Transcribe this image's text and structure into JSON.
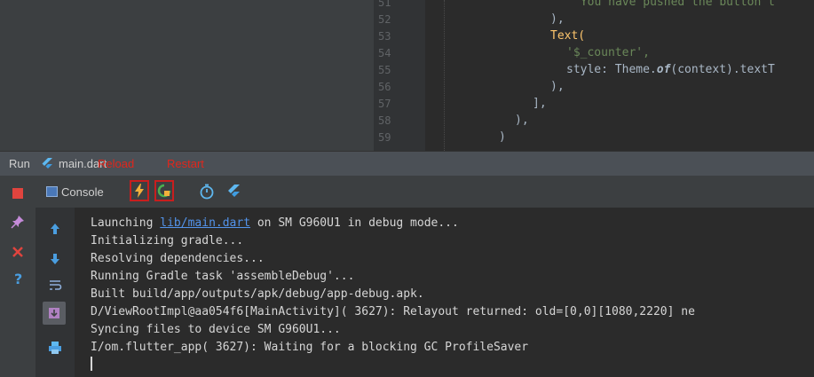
{
  "editor": {
    "line_numbers": [
      "51",
      "52",
      "53",
      "54",
      "55",
      "56",
      "57",
      "58",
      "59"
    ],
    "code_lines": [
      {
        "indent": "            ",
        "text": "'You have pushed the button t",
        "kind": "str"
      },
      {
        "indent": "          ",
        "text": "),",
        "kind": "plain"
      },
      {
        "indent": "          ",
        "text": "Text(",
        "kind": "call"
      },
      {
        "indent": "            ",
        "text": "'$_counter',",
        "kind": "str"
      },
      {
        "indent": "            ",
        "text_a": "style: Theme.",
        "text_b": "of",
        "text_c": "(context).textT",
        "kind": "style"
      },
      {
        "indent": "          ",
        "text": "),",
        "kind": "plain"
      },
      {
        "indent": "        ",
        "text": "],",
        "kind": "plain"
      },
      {
        "indent": "      ",
        "text": "),",
        "kind": "plain"
      },
      {
        "indent": "    ",
        "text": ")",
        "kind": "plain"
      }
    ]
  },
  "run_bar": {
    "run_label": "Run",
    "config_name": "main.dart",
    "hot_reload_label": "Reload",
    "hot_restart_label": "Restart"
  },
  "console_toolbar": {
    "tab_label": "Console"
  },
  "console": {
    "link_text": "lib/main.dart",
    "lines": [
      {
        "pre": "Launching ",
        "post": " on SM G960U1 in debug mode..."
      },
      {
        "text": "Initializing gradle..."
      },
      {
        "text": "Resolving dependencies..."
      },
      {
        "text": "Running Gradle task 'assembleDebug'..."
      },
      {
        "text": "Built build/app/outputs/apk/debug/app-debug.apk."
      },
      {
        "text": "D/ViewRootImpl@aa054f6[MainActivity]( 3627): Relayout returned: old=[0,0][1080,2220] ne"
      },
      {
        "text": "Syncing files to device SM G960U1..."
      },
      {
        "text": "I/om.flutter_app( 3627): Waiting for a blocking GC ProfileSaver"
      }
    ]
  },
  "colors": {
    "accent_red": "#e0261c",
    "link_blue": "#5394ec",
    "flutter_blue": "#5eb8f0"
  }
}
